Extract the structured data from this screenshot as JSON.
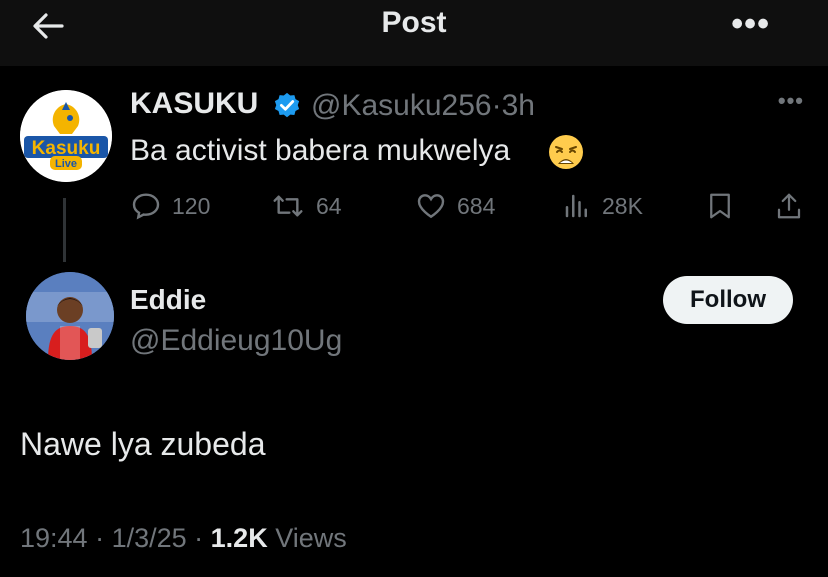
{
  "header": {
    "title": "Post",
    "back_icon": "arrow-left-icon",
    "more_icon": "more-horizontal-icon"
  },
  "original_post": {
    "avatar_logo_text": "Kasuku",
    "avatar_logo_sub": "Live",
    "author_name": "KASUKU",
    "verified_icon": "verified-badge-icon",
    "author_handle": "@Kasuku256",
    "separator": "·",
    "time": "3h",
    "text": "Ba activist babera mukwelya",
    "emoji": "weary-face-emoji",
    "stats": {
      "replies": "120",
      "reposts": "64",
      "likes": "684",
      "views": "28K"
    }
  },
  "reply_post": {
    "author_name": "Eddie",
    "author_handle": "@Eddieug10Ug",
    "follow_label": "Follow",
    "text": "Nawe lya zubeda",
    "time": "19:44",
    "date": "1/3/25",
    "views_count": "1.2K",
    "views_label": "Views"
  },
  "colors": {
    "background": "#000000",
    "muted": "#71767b",
    "text": "#e7e9ea",
    "verified": "#1d9bf0"
  }
}
